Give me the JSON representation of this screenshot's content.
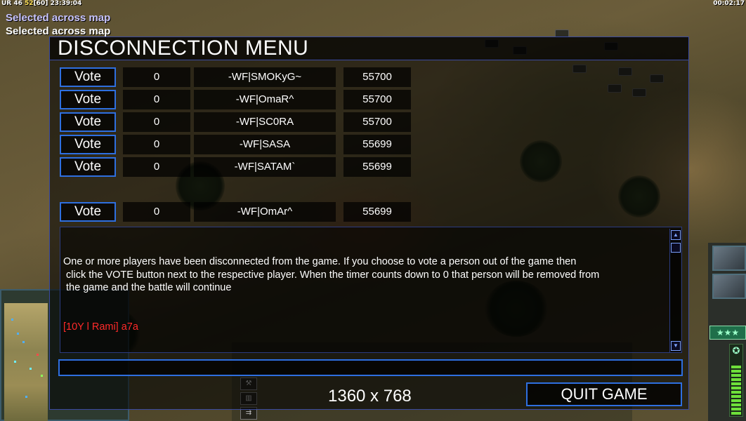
{
  "hud": {
    "top_left_prefix": "UR 46 ",
    "top_left_highlight": "52",
    "top_left_suffix": "[60] 23:39:04",
    "top_right": "00:02:17",
    "messages": [
      "Selected across map",
      "Selected across map"
    ],
    "rank_stars": "★★★"
  },
  "dialog": {
    "title": "DISCONNECTION MENU",
    "vote_label": "Vote",
    "players": [
      {
        "count": "0",
        "name": "-WF|SMOKyG~",
        "ping": "55700"
      },
      {
        "count": "0",
        "name": "-WF|OmaR^",
        "ping": "55700"
      },
      {
        "count": "0",
        "name": "-WF|SC0RA",
        "ping": "55700"
      },
      {
        "count": "0",
        "name": "-WF|SASA",
        "ping": "55699"
      },
      {
        "count": "0",
        "name": "-WF|SATAM`",
        "ping": "55699"
      },
      {
        "count": "0",
        "name": "-WF|OmAr^",
        "ping": "55699"
      }
    ],
    "info_text": "One or more players have been disconnected from the game. If you choose to vote a person out of the game then\n click the VOTE button next to the respective player. When the timer counts down to 0 that person will be removed from\n the game and the battle will continue",
    "chat_line": "[10Y l Rami] a7a",
    "chat_input_value": "",
    "resolution": "1360 x 768",
    "quit_label": "QUIT GAME"
  },
  "colors": {
    "accent_border": "#2e6fe0",
    "chat_highlight": "#ff2a2a",
    "message_primary": "#c8c4ff"
  },
  "icons": {
    "scroll_up": "▲",
    "scroll_down": "▼"
  }
}
